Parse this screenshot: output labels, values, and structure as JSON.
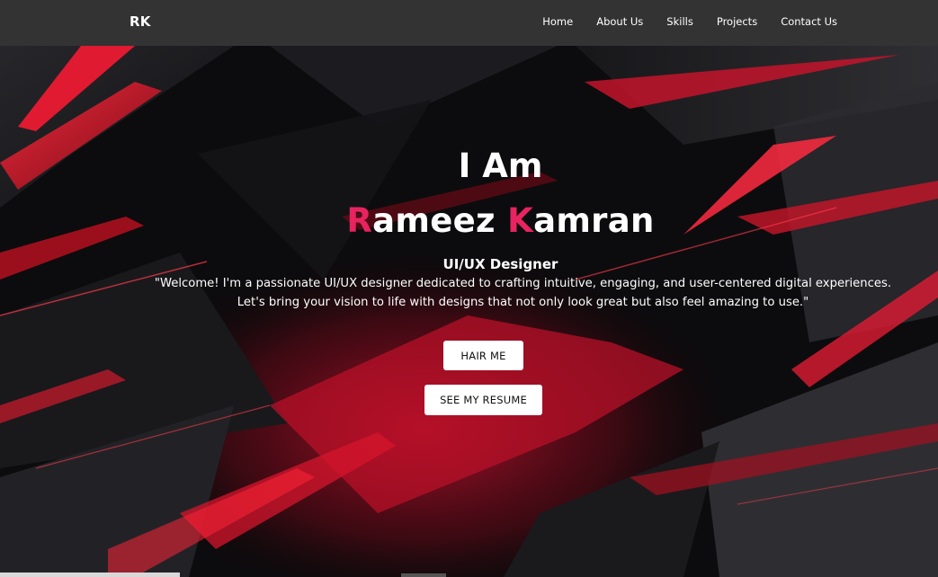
{
  "navbar": {
    "brand": "RK",
    "links": [
      "Home",
      "About Us",
      "Skills",
      "Projects",
      "Contact Us"
    ]
  },
  "hero": {
    "intro": "I Am",
    "name": {
      "first_initial": "R",
      "first_rest": "ameez ",
      "last_initial": "K",
      "last_rest": "amran"
    },
    "role": "UI/UX Designer",
    "description_line1": "\"Welcome! I'm a passionate UI/UX designer dedicated to crafting intuitive, engaging, and user-centered digital experiences.",
    "description_line2": "Let's bring your vision to life with designs that not only look great but also feel amazing to use.\"",
    "hire_button": "HAIR ME",
    "resume_button": "SEE MY RESUME"
  },
  "colors": {
    "navbar_bg": "#333333",
    "accent": "#e8235f",
    "background": "#0b0b0d",
    "shard_red": "#d4142f"
  }
}
